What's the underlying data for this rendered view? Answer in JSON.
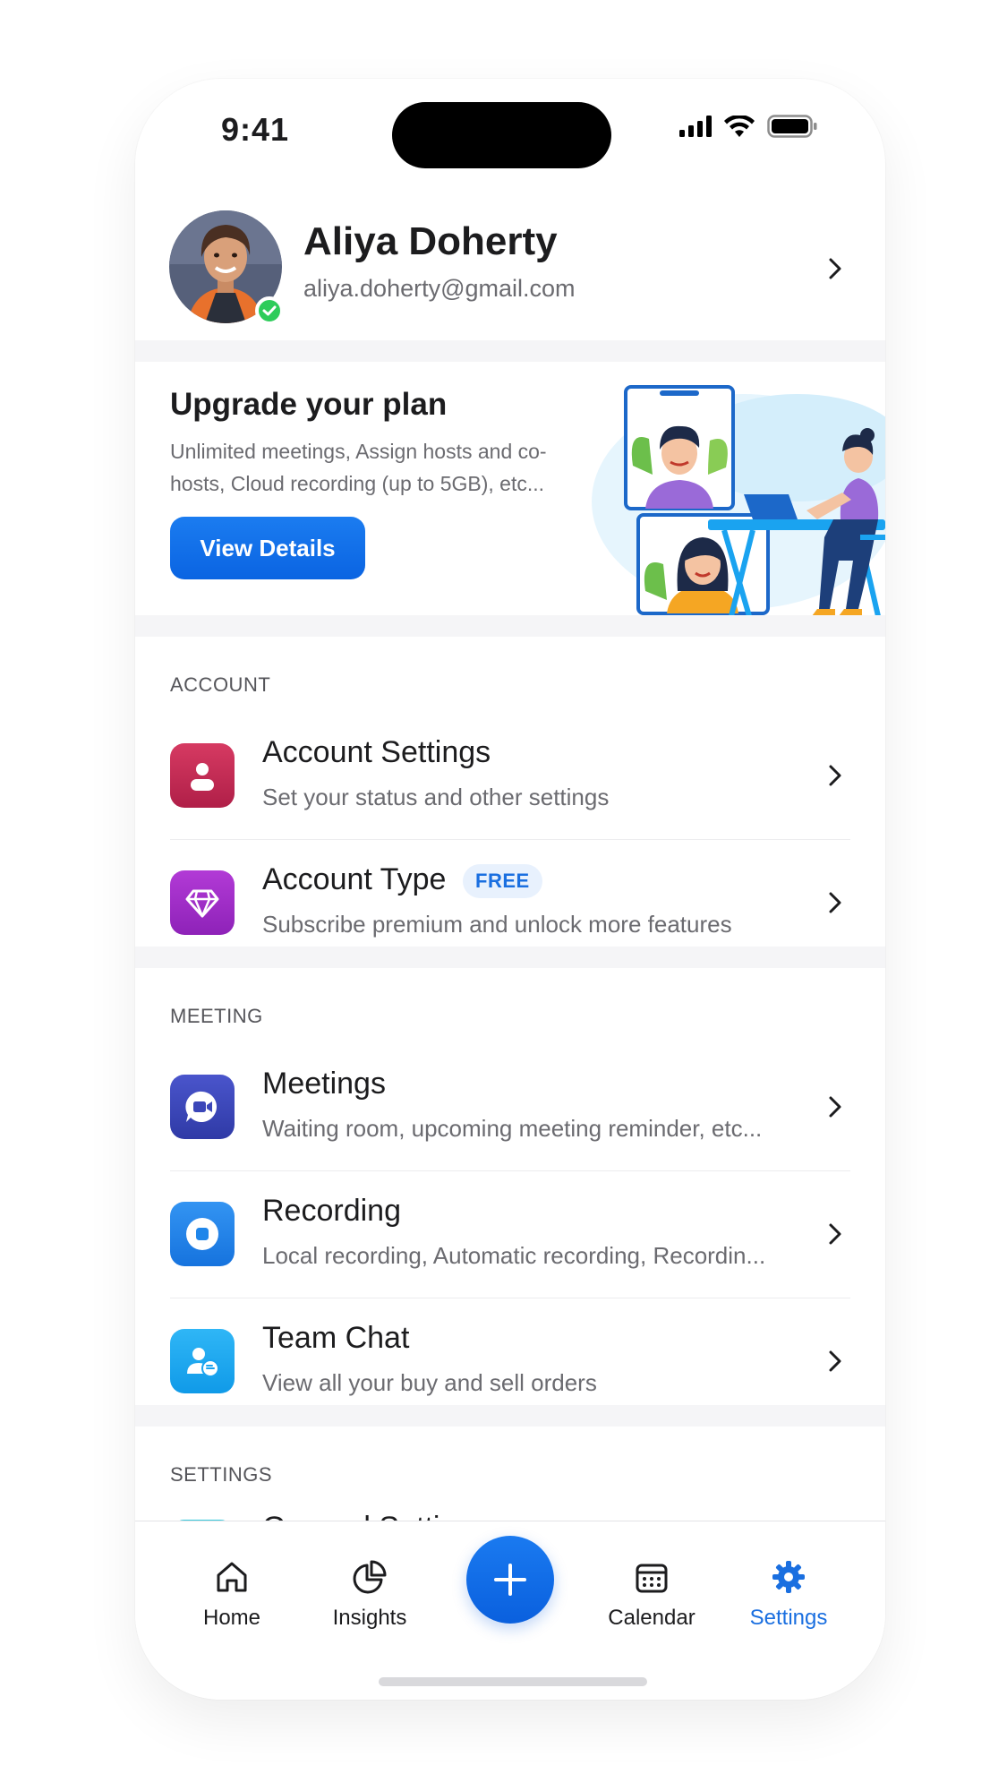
{
  "status_bar": {
    "time": "9:41"
  },
  "profile": {
    "name": "Aliya Doherty",
    "email": "aliya.doherty@gmail.com"
  },
  "upgrade": {
    "title": "Upgrade your plan",
    "description": "Unlimited meetings, Assign hosts and co-hosts, Cloud recording (up to 5GB), etc...",
    "button_label": "View Details"
  },
  "sections": {
    "account": {
      "label": "ACCOUNT",
      "items": [
        {
          "title": "Account Settings",
          "subtitle": "Set your status and other settings",
          "icon": "person-icon",
          "color": "#c0264e"
        },
        {
          "title": "Account Type",
          "badge": "FREE",
          "subtitle": "Subscribe premium and unlock more features",
          "icon": "diamond-icon",
          "color": "#9b2bc2"
        }
      ]
    },
    "meeting": {
      "label": "MEETING",
      "items": [
        {
          "title": "Meetings",
          "subtitle": "Waiting room, upcoming meeting reminder, etc...",
          "icon": "video-chat-icon",
          "color": "#3b46b8"
        },
        {
          "title": "Recording",
          "subtitle": "Local recording, Automatic recording, Recordin...",
          "icon": "record-icon",
          "color": "#1f86ea"
        },
        {
          "title": "Team Chat",
          "subtitle": "View all your buy and sell orders",
          "icon": "team-chat-icon",
          "color": "#1aa3f0"
        }
      ]
    },
    "settings": {
      "label": "SETTINGS",
      "items": [
        {
          "title": "General Settings",
          "icon": "settings-icon",
          "color": "#22b8cf"
        }
      ]
    }
  },
  "nav": {
    "tabs": [
      {
        "label": "Home",
        "icon": "home-icon"
      },
      {
        "label": "Insights",
        "icon": "pie-chart-icon"
      },
      {
        "label": "Calendar",
        "icon": "calendar-icon"
      },
      {
        "label": "Settings",
        "icon": "gear-icon",
        "active": true
      }
    ],
    "fab_icon": "plus-icon"
  },
  "colors": {
    "accent": "#1a6fe0",
    "online": "#2ecc5a"
  }
}
